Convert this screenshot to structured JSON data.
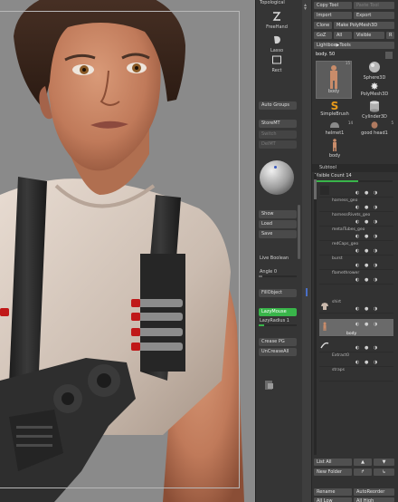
{
  "shelf": {
    "topological_label": "Topological",
    "freehand_label": "FreeHand",
    "lasso_label": "Lasso",
    "rect_label": "Rect",
    "auto_groups": "Auto Groups",
    "store_mt": "StoreMT",
    "switch": "Switch",
    "del_mt": "DelMT",
    "show": "Show",
    "load": "Load",
    "save": "Save",
    "live_boolean": "Live Boolean",
    "angle": "Angle 0",
    "fill_object": "FillObject",
    "lazy_mouse": "LazyMouse",
    "lazy_radius": "LazyRadius 1",
    "crease_pg": "Crease PG",
    "uncrease_all": "UnCreaseAll"
  },
  "palette": {
    "copy_tool": "Copy Tool",
    "paste_tool": "Paste Tool",
    "import": "Import",
    "export": "Export",
    "clone": "Clone",
    "make_polymesh": "Make PolyMesh3D",
    "goz": "GoZ",
    "all": "All",
    "visible": "Visible",
    "r": "R",
    "lightbox_tools": "Lightbox▶Tools",
    "current_tool": "body. 50",
    "tools": [
      {
        "name": "body",
        "count": "15"
      },
      {
        "name": "Sphere3D",
        "count": ""
      },
      {
        "name": "PolyMesh3D",
        "count": ""
      },
      {
        "name": "SimpleBrush",
        "count": ""
      },
      {
        "name": "Cylinder3D",
        "count": ""
      },
      {
        "name": "helmet1",
        "count": "14"
      },
      {
        "name": "good head1",
        "count": "5"
      },
      {
        "name": "body",
        "count": ""
      }
    ],
    "subtool_header": "Subtool",
    "visible_count": "Visible Count 14",
    "subtools": [
      {
        "name": ""
      },
      {
        "name": "harness_geo"
      },
      {
        "name": "harnessRivets_geo"
      },
      {
        "name": "metalTubes_geo"
      },
      {
        "name": "redCaps_geo"
      },
      {
        "name": "burst"
      },
      {
        "name": "flamethrower"
      },
      {
        "name": "shirt"
      },
      {
        "name": "body"
      },
      {
        "name": ""
      },
      {
        "name": "Extract0"
      },
      {
        "name": "straps"
      }
    ],
    "list_all": "List All",
    "new_folder": "New Folder",
    "rename": "Rename",
    "auto_reorder": "AutoReorder",
    "all_low": "All Low",
    "all_high": "All High"
  },
  "colors": {
    "accent_green": "#39b54a",
    "panel_bg": "#323232",
    "viewport_bg": "#8a8a8a"
  }
}
